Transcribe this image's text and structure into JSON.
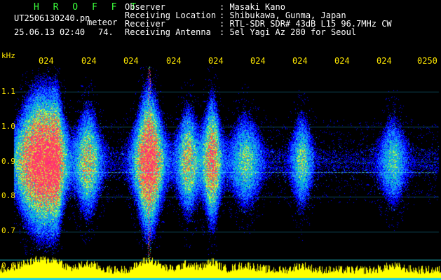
{
  "header": {
    "app_title": "H R O F F T",
    "file_name": "UT2506130240.pn",
    "file_suffix": "meteor",
    "timestamp": "25.06.13 02:40",
    "value": "74.",
    "info_labels": [
      "Observer",
      "Receiving Location",
      "Receiver",
      "Receiving Antenna"
    ],
    "info_values": [
      ": Masaki Kano",
      ": Shibukawa, Gunma, Japan",
      ": RTL-SDR SDR# 43dB L15 96.7MHz CW",
      ": 5el Yagi Az 280 for Seoul"
    ]
  },
  "spectrogram": {
    "y_unit": "kHz",
    "y_ticks": [
      "1.1",
      "1.0",
      "0.9",
      "0.8",
      "0.7",
      "0.6"
    ],
    "y_tick_values": [
      1.1,
      1.0,
      0.9,
      0.8,
      0.7,
      0.6
    ],
    "y_range": [
      0.6,
      1.15
    ],
    "time_ticks": [
      "024",
      "024",
      "024",
      "024",
      "024",
      "024",
      "024",
      "024",
      "024",
      "0250"
    ],
    "colors": {
      "background": "#000000",
      "noise_low": "#0000ff",
      "noise_mid": "#00c8c8",
      "signal_high": "#ff2a7a",
      "activity_bar": "#ffff00",
      "tick_text": "#ffe800"
    }
  }
}
